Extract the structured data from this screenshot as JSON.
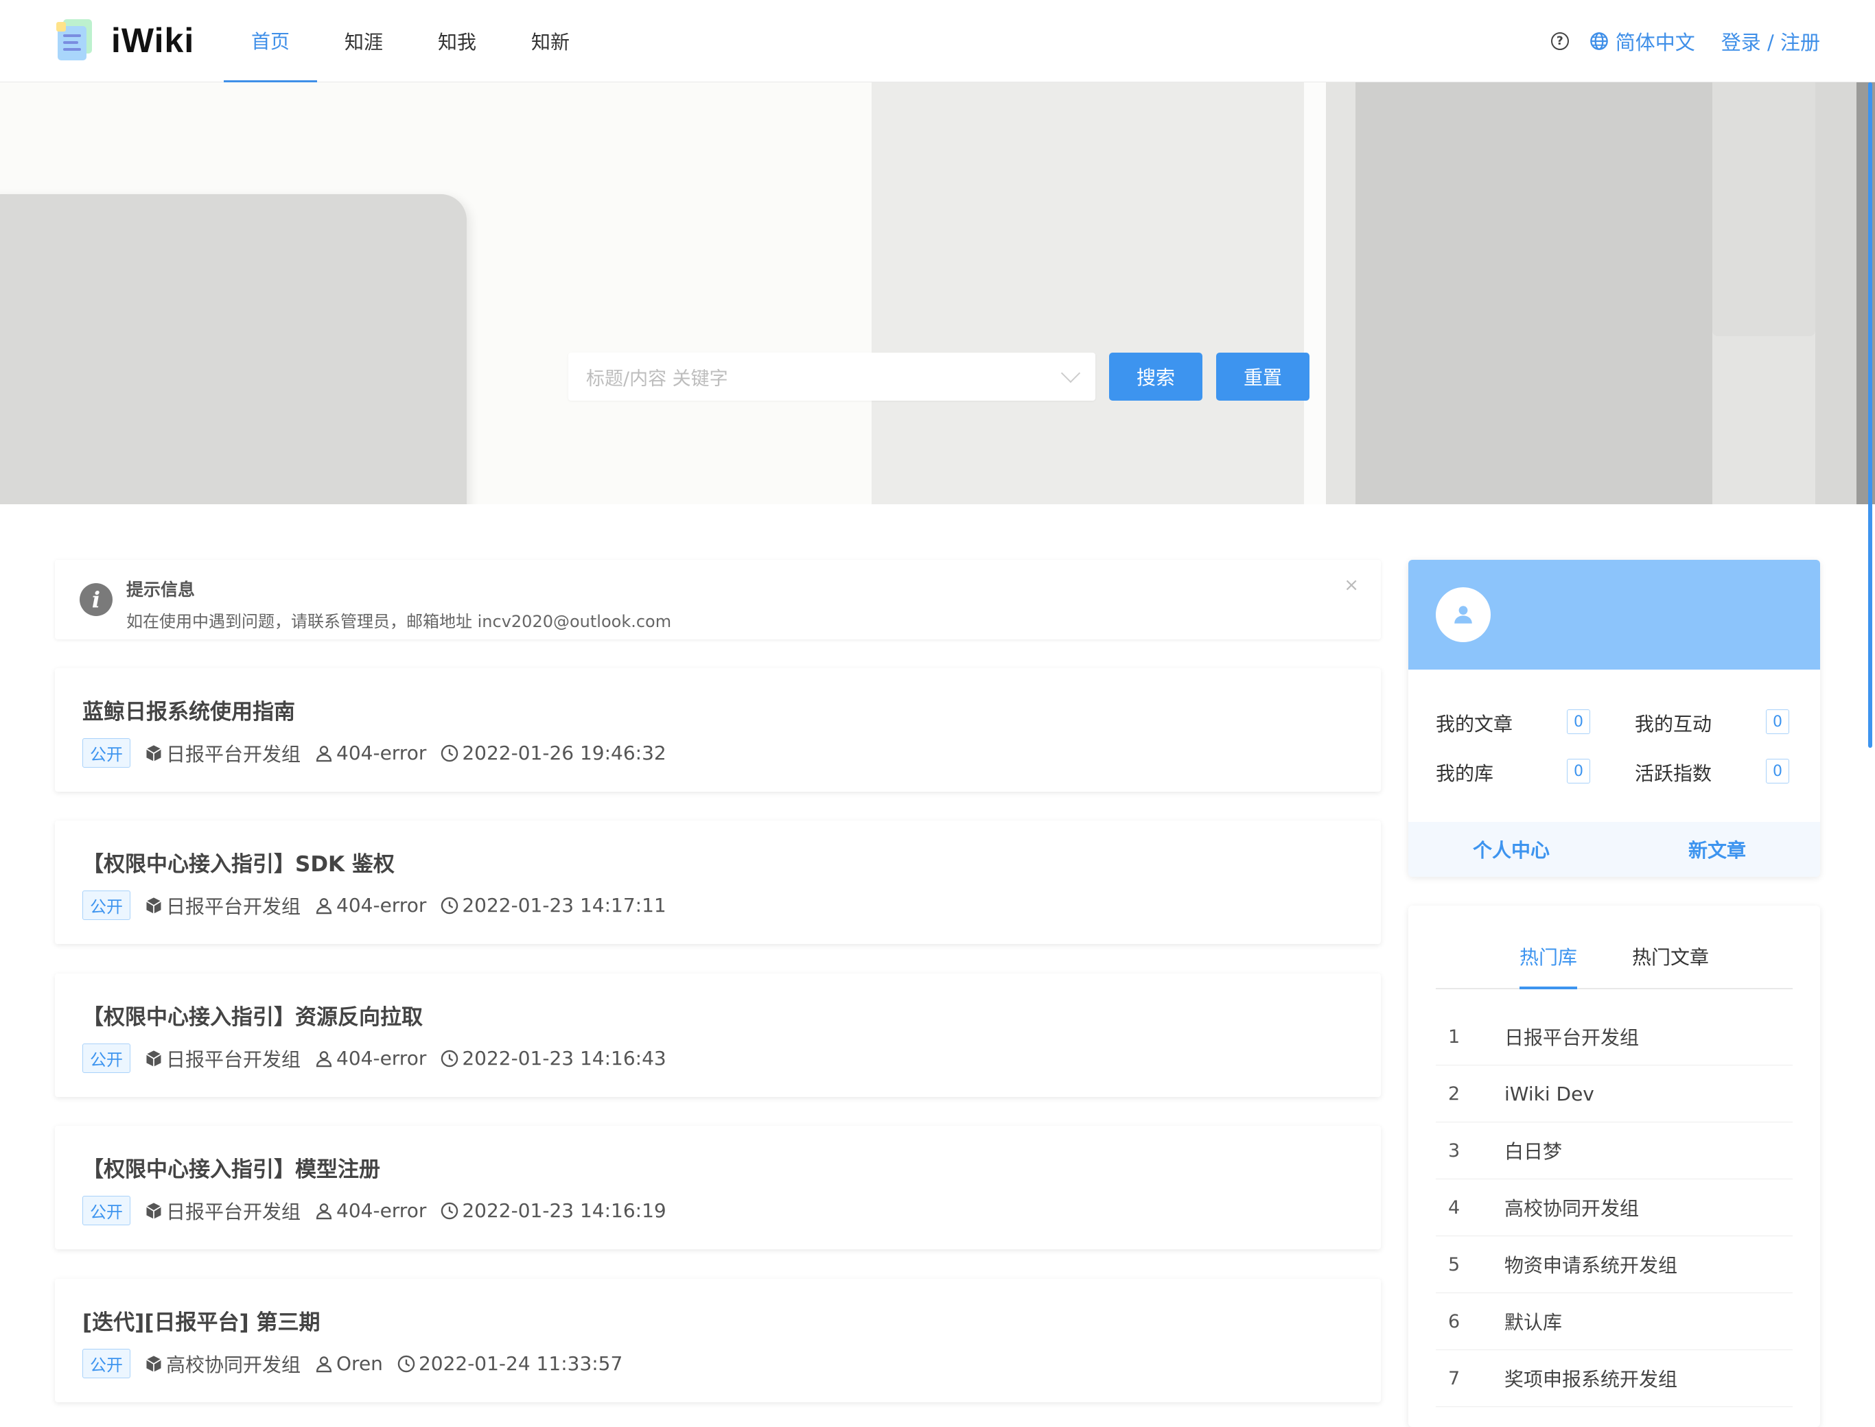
{
  "app": {
    "name": "iWiki"
  },
  "nav": {
    "items": [
      {
        "label": "首页",
        "active": true
      },
      {
        "label": "知涯",
        "active": false
      },
      {
        "label": "知我",
        "active": false
      },
      {
        "label": "知新",
        "active": false
      }
    ]
  },
  "header": {
    "help": "?",
    "language": "简体中文",
    "login": "登录 / 注册"
  },
  "search": {
    "placeholder": "标题/内容 关键字",
    "search_label": "搜索",
    "reset_label": "重置"
  },
  "notice": {
    "title": "提示信息",
    "message": "如在使用中遇到问题，请联系管理员，邮箱地址 incv2020@outlook.com",
    "close": "×"
  },
  "articles": [
    {
      "title": "蓝鲸日报系统使用指南",
      "tag": "公开",
      "group": "日报平台开发组",
      "author": "404-error",
      "time": "2022-01-26 19:46:32"
    },
    {
      "title": "【权限中心接入指引】SDK 鉴权",
      "tag": "公开",
      "group": "日报平台开发组",
      "author": "404-error",
      "time": "2022-01-23 14:17:11"
    },
    {
      "title": "【权限中心接入指引】资源反向拉取",
      "tag": "公开",
      "group": "日报平台开发组",
      "author": "404-error",
      "time": "2022-01-23 14:16:43"
    },
    {
      "title": "【权限中心接入指引】模型注册",
      "tag": "公开",
      "group": "日报平台开发组",
      "author": "404-error",
      "time": "2022-01-23 14:16:19"
    },
    {
      "title": "[迭代][日报平台] 第三期",
      "tag": "公开",
      "group": "高校协同开发组",
      "author": "Oren",
      "time": "2022-01-24 11:33:57"
    }
  ],
  "profile": {
    "stats": [
      {
        "label": "我的文章",
        "value": "0"
      },
      {
        "label": "我的互动",
        "value": "0"
      },
      {
        "label": "我的库",
        "value": "0"
      },
      {
        "label": "活跃指数",
        "value": "0"
      }
    ],
    "personal_center": "个人中心",
    "new_article": "新文章"
  },
  "hot": {
    "tabs": [
      {
        "label": "热门库",
        "active": true
      },
      {
        "label": "热门文章",
        "active": false
      }
    ],
    "items": [
      {
        "index": "1",
        "name": "日报平台开发组"
      },
      {
        "index": "2",
        "name": "iWiki Dev"
      },
      {
        "index": "3",
        "name": "白日梦"
      },
      {
        "index": "4",
        "name": "高校协同开发组"
      },
      {
        "index": "5",
        "name": "物资申请系统开发组"
      },
      {
        "index": "6",
        "name": "默认库"
      },
      {
        "index": "7",
        "name": "奖项申报系统开发组"
      }
    ]
  },
  "colors": {
    "accent": "#3d94ef",
    "profile_header": "#8cc4fb",
    "tag_bg": "#ecf6ff"
  }
}
